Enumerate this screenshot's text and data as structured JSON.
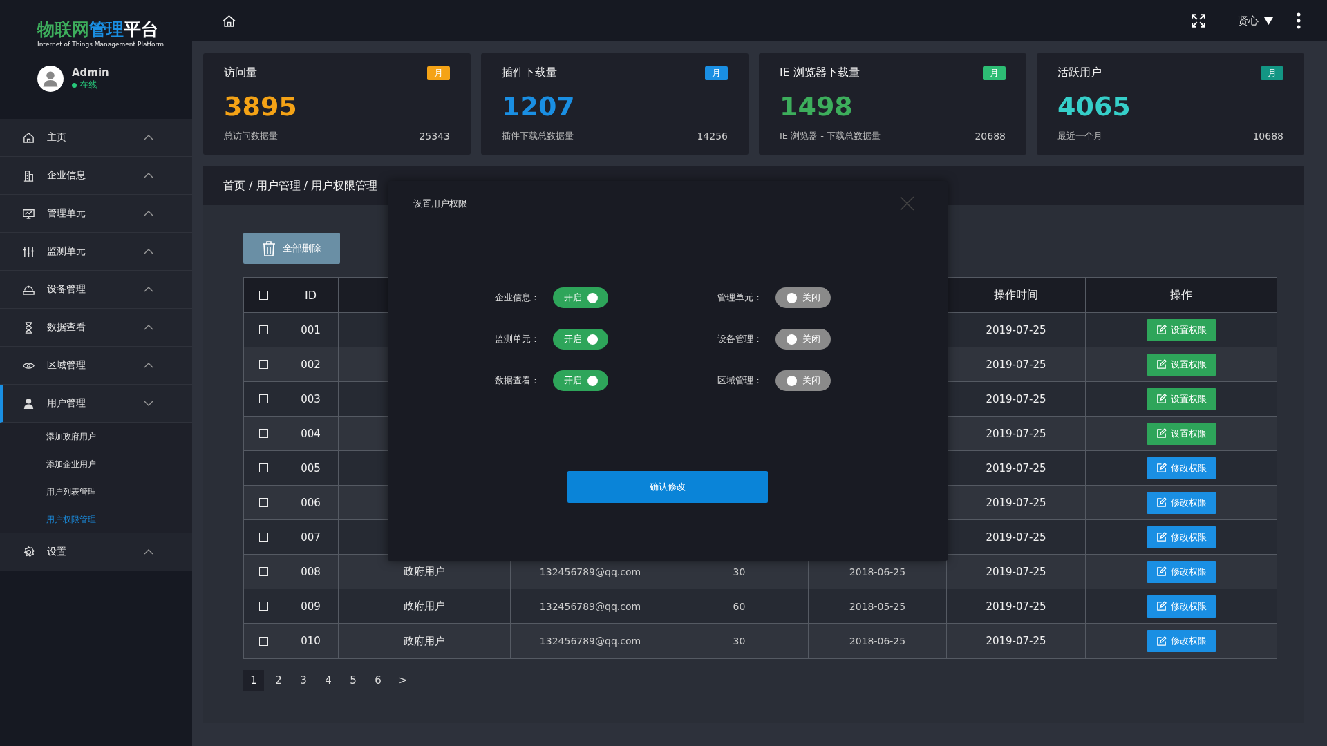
{
  "logo": {
    "segments": [
      {
        "text": "物联网",
        "color": "#3dae5c"
      },
      {
        "text": "管理",
        "color": "#1a8fe3"
      },
      {
        "text": "平台",
        "color": "#ffffff"
      }
    ],
    "subtitle": "Internet of Things Management Platform"
  },
  "user": {
    "name": "Admin",
    "status": "在线"
  },
  "header": {
    "user_menu": "贤心"
  },
  "sidebar": {
    "items": [
      {
        "label": "主页",
        "expanded": false
      },
      {
        "label": "企业信息",
        "expanded": false
      },
      {
        "label": "管理单元",
        "expanded": false
      },
      {
        "label": "监测单元",
        "expanded": false
      },
      {
        "label": "设备管理",
        "expanded": false
      },
      {
        "label": "数据查看",
        "expanded": false
      },
      {
        "label": "区域管理",
        "expanded": false
      },
      {
        "label": "用户管理",
        "expanded": true,
        "children": [
          {
            "label": "添加政府用户",
            "selected": false
          },
          {
            "label": "添加企业用户",
            "selected": false
          },
          {
            "label": "用户列表管理",
            "selected": false
          },
          {
            "label": "用户权限管理",
            "selected": true
          }
        ]
      },
      {
        "label": "设置",
        "expanded": false
      }
    ]
  },
  "stats": [
    {
      "title": "访问量",
      "badge": {
        "text": "月",
        "color": "#f5a316"
      },
      "value": "3895",
      "color": "#f5a316",
      "caption": "总访问数据量",
      "total": "25343"
    },
    {
      "title": "插件下载量",
      "badge": {
        "text": "月",
        "color": "#1a8fe3"
      },
      "value": "1207",
      "color": "#1a8fe3",
      "caption": "插件下载总数据量",
      "total": "14256"
    },
    {
      "title": "IE 浏览器下载量",
      "badge": {
        "text": "月",
        "color": "#2dbd74"
      },
      "value": "1498",
      "color": "#3dae5c",
      "caption": "IE 浏览器 - 下载总数据量",
      "total": "20688"
    },
    {
      "title": "活跃用户",
      "badge": {
        "text": "月",
        "color": "#139684"
      },
      "value": "4065",
      "color": "#36cfc9",
      "caption": "最近一个月",
      "total": "10688"
    }
  ],
  "breadcrumb": "首页 / 用户管理 / 用户权限管理",
  "delete_all_button": "全部删除",
  "table": {
    "header": {
      "checked": false,
      "id": "ID",
      "op_time": "操作时间",
      "action": "操作"
    },
    "rows": [
      {
        "checked": false,
        "id": "001",
        "op_time": "2019-07-25",
        "action": {
          "kind": "set",
          "label": "设置权限"
        }
      },
      {
        "checked": false,
        "id": "002",
        "op_time": "2019-07-25",
        "action": {
          "kind": "set",
          "label": "设置权限"
        }
      },
      {
        "checked": false,
        "id": "003",
        "op_time": "2019-07-25",
        "action": {
          "kind": "set",
          "label": "设置权限"
        }
      },
      {
        "checked": false,
        "id": "004",
        "op_time": "2019-07-25",
        "action": {
          "kind": "set",
          "label": "设置权限"
        }
      },
      {
        "checked": false,
        "id": "005",
        "op_time": "2019-07-25",
        "action": {
          "kind": "edit",
          "label": "修改权限"
        }
      },
      {
        "checked": false,
        "id": "006",
        "op_time": "2019-07-25",
        "action": {
          "kind": "edit",
          "label": "修改权限"
        }
      },
      {
        "checked": false,
        "id": "007",
        "op_time": "2019-07-25",
        "action": {
          "kind": "edit",
          "label": "修改权限"
        }
      },
      {
        "checked": false,
        "id": "008",
        "type": "政府用户",
        "email": "132456789@qq.com",
        "column_5": "30",
        "joined": "2018-06-25",
        "op_time": "2019-07-25",
        "action": {
          "kind": "edit",
          "label": "修改权限"
        }
      },
      {
        "checked": false,
        "id": "009",
        "type": "政府用户",
        "email": "132456789@qq.com",
        "column_5": "60",
        "joined": "2018-05-25",
        "op_time": "2019-07-25",
        "action": {
          "kind": "edit",
          "label": "修改权限"
        }
      },
      {
        "checked": false,
        "id": "010",
        "type": "政府用户",
        "email": "132456789@qq.com",
        "column_5": "30",
        "joined": "2018-06-25",
        "op_time": "2019-07-25",
        "action": {
          "kind": "edit",
          "label": "修改权限"
        }
      }
    ]
  },
  "pagination": {
    "pages": [
      {
        "label": "1",
        "selected": true
      },
      {
        "label": "2",
        "selected": false
      },
      {
        "label": "3",
        "selected": false
      },
      {
        "label": "4",
        "selected": false
      },
      {
        "label": "5",
        "selected": false
      },
      {
        "label": "6",
        "selected": false
      }
    ],
    "next": ">"
  },
  "modal": {
    "title": "设置用户权限",
    "switches": [
      {
        "label": "企业信息：",
        "on": true,
        "text": "开启"
      },
      {
        "label": "管理单元：",
        "on": false,
        "text": "关闭"
      },
      {
        "label": "监测单元：",
        "on": true,
        "text": "开启"
      },
      {
        "label": "设备管理：",
        "on": false,
        "text": "关闭"
      },
      {
        "label": "数据查看：",
        "on": true,
        "text": "开启"
      },
      {
        "label": "区域管理：",
        "on": false,
        "text": "关闭"
      }
    ],
    "confirm": "确认修改"
  }
}
